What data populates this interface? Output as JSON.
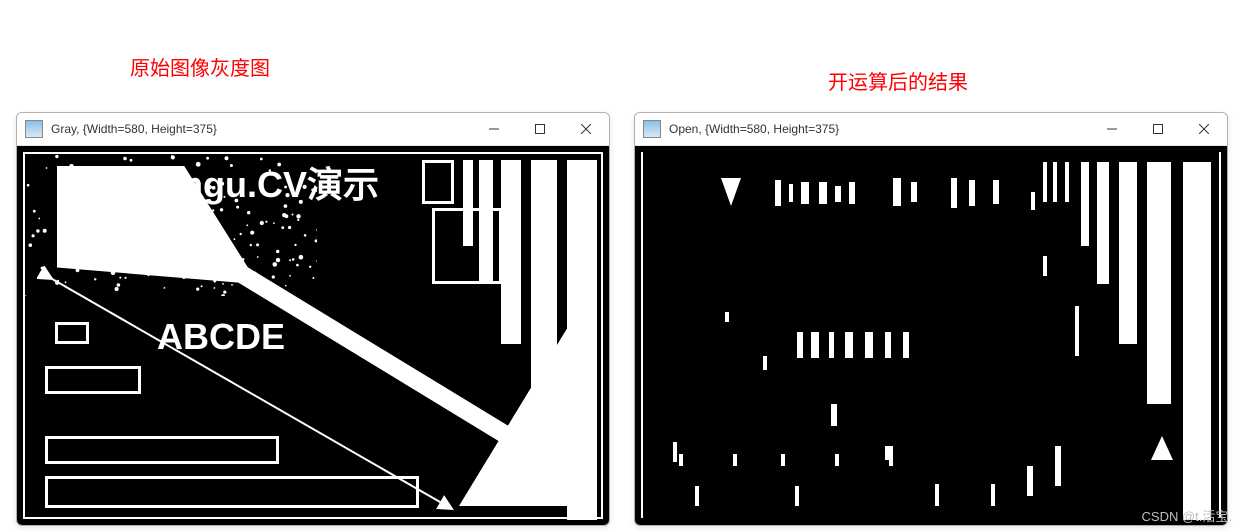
{
  "captions": {
    "left": "原始图像灰度图",
    "right": "开运算后的结果"
  },
  "windows": {
    "left": {
      "title": "Gray, {Width=580, Height=375}",
      "text1": "Emgu.CV演示",
      "text2": "ABCDE"
    },
    "right": {
      "title": "Open, {Width=580, Height=375}"
    }
  },
  "watermark": "CSDN @t.活宝.",
  "icons": {
    "minimize": "minimize-icon",
    "maximize": "maximize-icon",
    "close": "close-icon"
  }
}
